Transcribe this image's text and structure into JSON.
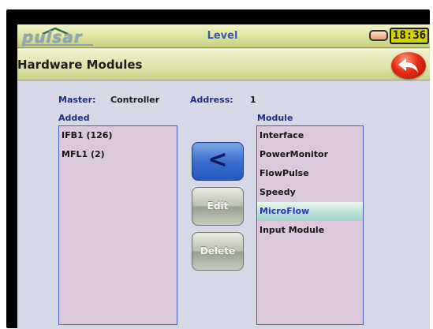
{
  "status_bar": {
    "logo_text": "pulsar",
    "screen_title": "Level",
    "clock": "18:36"
  },
  "header": {
    "title": "Hardware Modules"
  },
  "info": {
    "master_label": "Master:",
    "master_value": "Controller",
    "address_label": "Address:",
    "address_value": "1"
  },
  "added": {
    "label": "Added",
    "items": [
      "IFB1 (126)",
      "MFL1 (2)"
    ]
  },
  "module": {
    "label": "Module",
    "items": [
      "Interface",
      "PowerMonitor",
      "FlowPulse",
      "Speedy",
      "MicroFlow",
      "Input Module"
    ],
    "selected": "MicroFlow"
  },
  "buttons": {
    "move_left": "<",
    "edit": "Edit",
    "delete": "Delete"
  }
}
